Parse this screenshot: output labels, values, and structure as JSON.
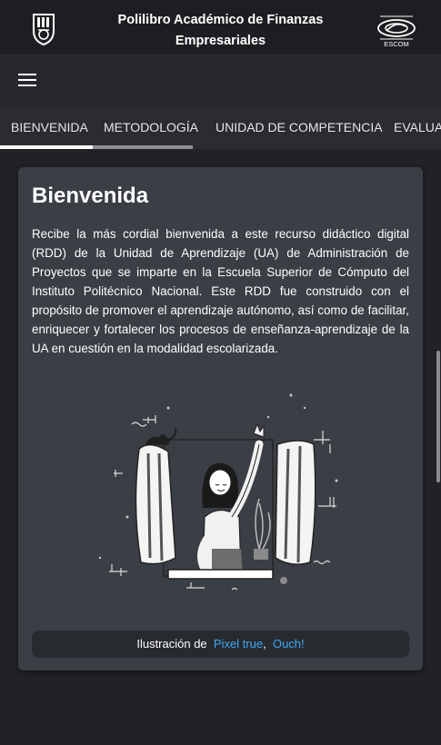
{
  "header": {
    "title_line1": "Polilibro Académico de Finanzas",
    "title_line2": "Empresariales",
    "left_logo_icon": "ipn-logo-icon",
    "right_logo_icon": "escom-logo-icon",
    "right_logo_text": "ESCOM"
  },
  "toolbar": {
    "menu_icon": "hamburger-menu-icon"
  },
  "tabs": [
    {
      "label": "BIENVENIDA",
      "active": true
    },
    {
      "label": "METODOLOGÍA",
      "active": false
    },
    {
      "label": "UNIDAD DE COMPETENCIA",
      "active": false
    },
    {
      "label": "EVALUACIÓN",
      "active": false
    }
  ],
  "card": {
    "title": "Bienvenida",
    "body": "Recibe la más cordial bienvenida a este recurso didáctico digital (RDD) de la Unidad de Aprendizaje (UA) de Administración de Proyectos que se imparte en la Escuela Superior de Cómputo del Instituto Politécnico Nacional. Este RDD fue construido con el propósito de promover el aprendizaje autónomo, así como de facilitar, enriquecer y fortalecer los procesos de enseñanza-aprendizaje de la UA en cuestión en la modalidad escolarizada.",
    "illustration_icon": "woman-waving-window-illustration"
  },
  "credit": {
    "prefix": "Ilustración de",
    "link1": "Pixel true",
    "separator": ",",
    "link2": "Ouch!"
  },
  "colors": {
    "background": "#202226",
    "card": "#3a3e45",
    "link": "#3fa9f5",
    "active_tab_indicator": "#ffffff",
    "inactive_tab_indicator": "#8e9094"
  }
}
